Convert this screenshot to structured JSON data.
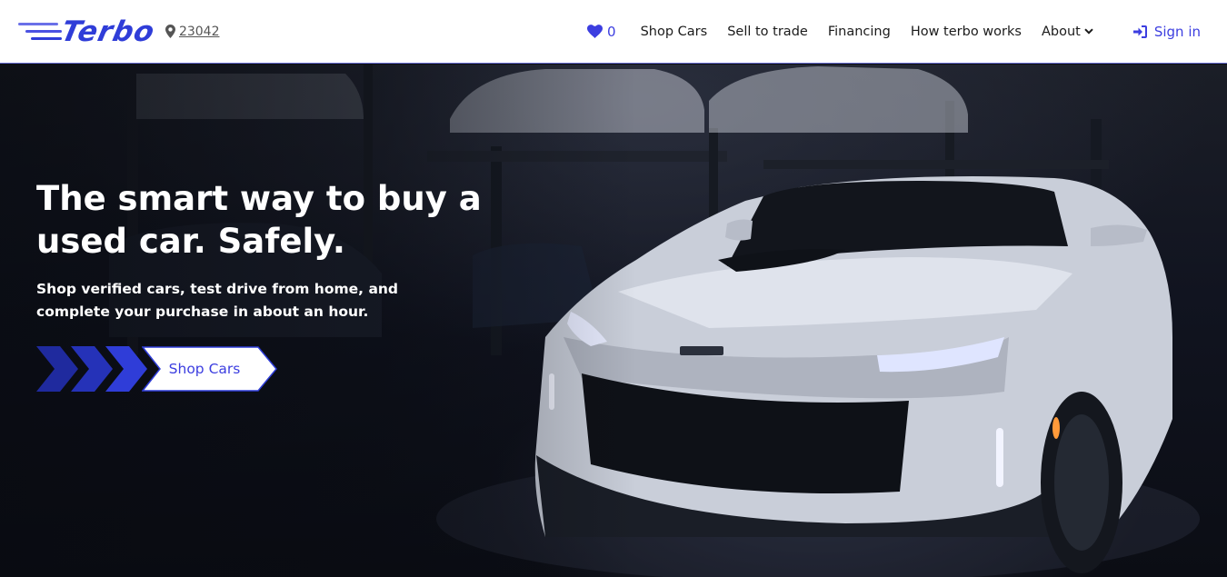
{
  "brand": {
    "name": "Terbo",
    "color": "#2f3dd8"
  },
  "location": {
    "zip": "23042"
  },
  "nav": {
    "favorites_count": "0",
    "items": [
      "Shop Cars",
      "Sell to trade",
      "Financing",
      "How terbo works"
    ],
    "about_label": "About",
    "signin_label": "Sign in"
  },
  "hero": {
    "title": "The smart way to buy a used car. Safely.",
    "subtitle": "Shop verified cars, test drive from home, and complete your purchase in about an hour.",
    "cta_label": "Shop Cars"
  },
  "colors": {
    "accent": "#3c3ee0",
    "arrow_dark": "#1f2a9e",
    "arrow_light": "#2f3dd8"
  },
  "icons": [
    "location-pin-icon",
    "heart-icon",
    "chevron-down-icon",
    "sign-in-icon",
    "chevron-arrow-icon"
  ]
}
